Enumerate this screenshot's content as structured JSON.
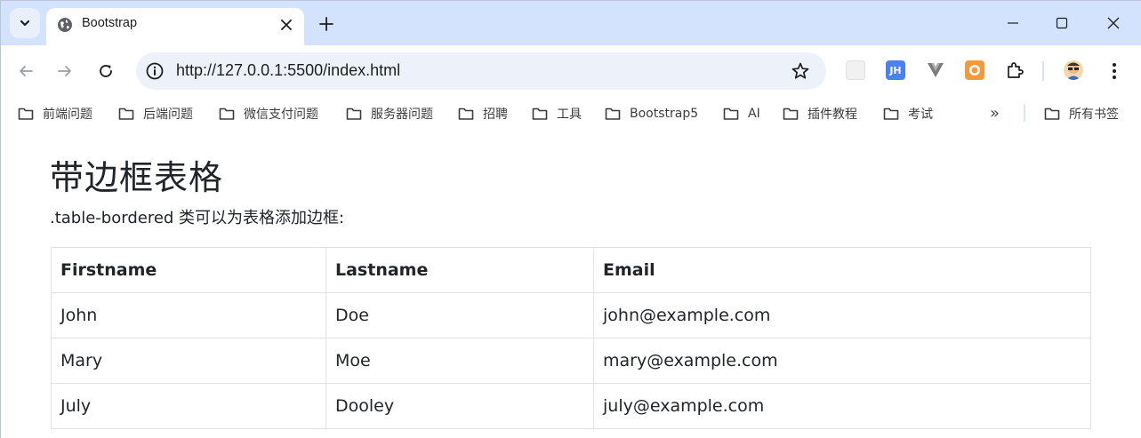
{
  "browser": {
    "tab_title": "Bootstrap",
    "url": "http://127.0.0.1:5500/index.html",
    "accent": "#d3e3fd"
  },
  "bookmarks": [
    {
      "label": "前端问题"
    },
    {
      "label": "后端问题"
    },
    {
      "label": "微信支付问题"
    },
    {
      "label": "服务器问题"
    },
    {
      "label": "招聘"
    },
    {
      "label": "工具"
    },
    {
      "label": "Bootstrap5"
    },
    {
      "label": "AI"
    },
    {
      "label": "插件教程"
    },
    {
      "label": "考试"
    }
  ],
  "bookmarks_overflow": "»",
  "all_bookmarks": "所有书签",
  "page": {
    "heading": "带边框表格",
    "lead": ".table-bordered 类可以为表格添加边框:",
    "table": {
      "headers": [
        "Firstname",
        "Lastname",
        "Email"
      ],
      "rows": [
        [
          "John",
          "Doe",
          "john@example.com"
        ],
        [
          "Mary",
          "Moe",
          "mary@example.com"
        ],
        [
          "July",
          "Dooley",
          "july@example.com"
        ]
      ]
    }
  }
}
